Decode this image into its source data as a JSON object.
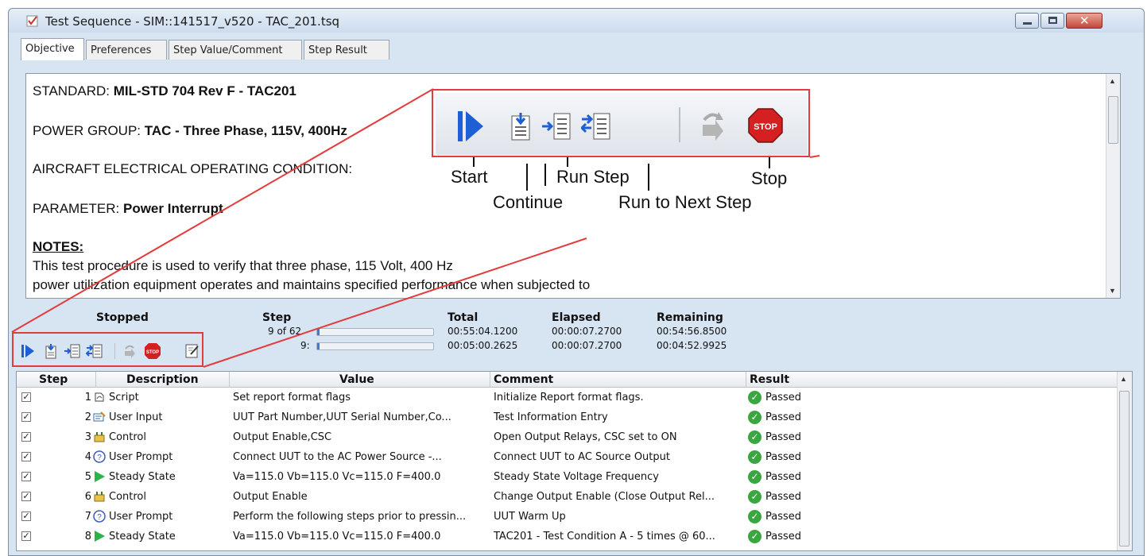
{
  "window": {
    "title": "Test Sequence - SIM::141517_v520 - TAC_201.tsq",
    "buttons": [
      "minimize",
      "maximize",
      "close"
    ]
  },
  "tabs": [
    {
      "label": "Objective",
      "active": true
    },
    {
      "label": "Preferences",
      "active": false
    },
    {
      "label": "Step Value/Comment",
      "active": false
    },
    {
      "label": "Step Result",
      "active": false
    }
  ],
  "objective": {
    "standard_label": "STANDARD: ",
    "standard_value": "MIL-STD 704 Rev F - TAC201",
    "power_group_label": "POWER GROUP: ",
    "power_group_value": "TAC - Three Phase, 115V, 400Hz",
    "condition_label": "AIRCRAFT ELECTRICAL OPERATING CONDITION:",
    "parameter_label": "PARAMETER:  ",
    "parameter_value": "Power Interrupt",
    "notes_heading": "NOTES:",
    "notes_line1": "This test procedure is used to verify that three phase, 115 Volt, 400 Hz",
    "notes_line2": "power utilization equipment operates and maintains specified performance when subjected to"
  },
  "callout": {
    "start": "Start",
    "continue": "Continue",
    "run_step": "Run Step",
    "run_to_next_step": "Run to Next Step",
    "stop": "Stop",
    "stop_icon_text": "STOP"
  },
  "status": {
    "state": "Stopped",
    "step_header": "Step",
    "step_value": "9 of 62",
    "step_sub": "9:",
    "total_header": "Total",
    "total_1": "00:55:04.1200",
    "total_2": "00:05:00.2625",
    "elapsed_header": "Elapsed",
    "elapsed_1": "00:00:07.2700",
    "elapsed_2": "00:00:07.2700",
    "remaining_header": "Remaining",
    "remaining_1": "00:54:56.8500",
    "remaining_2": "00:04:52.9925",
    "progress_overall": 0.02,
    "progress_step": 0.02
  },
  "grid": {
    "headers": {
      "step": "Step",
      "description": "Description",
      "value": "Value",
      "comment": "Comment",
      "result": "Result"
    },
    "rows": [
      {
        "n": "1",
        "icon": "script-icon",
        "desc": "Script",
        "value": "Set report format flags",
        "comment": "Initialize Report format flags.",
        "result": "Passed"
      },
      {
        "n": "2",
        "icon": "user-input-icon",
        "desc": "User Input",
        "value": "UUT Part Number,UUT Serial Number,Co...",
        "comment": "Test Information Entry",
        "result": "Passed"
      },
      {
        "n": "3",
        "icon": "control-icon",
        "desc": "Control",
        "value": "Output Enable,CSC",
        "comment": "Open Output Relays, CSC set to ON",
        "result": "Passed"
      },
      {
        "n": "4",
        "icon": "user-prompt-icon",
        "desc": "User Prompt",
        "value": "Connect  UUT to the AC Power Source  -...",
        "comment": "Connect UUT to AC Source Output",
        "result": "Passed"
      },
      {
        "n": "5",
        "icon": "steady-state-icon",
        "desc": "Steady State",
        "value": "Va=115.0 Vb=115.0 Vc=115.0 F=400.0",
        "comment": "Steady State Voltage Frequency",
        "result": "Passed"
      },
      {
        "n": "6",
        "icon": "control-icon",
        "desc": "Control",
        "value": "Output Enable",
        "comment": "Change Output Enable (Close Output Rel...",
        "result": "Passed"
      },
      {
        "n": "7",
        "icon": "user-prompt-icon",
        "desc": "User Prompt",
        "value": "Perform the following steps prior to pressin...",
        "comment": "UUT Warm Up",
        "result": "Passed"
      },
      {
        "n": "8",
        "icon": "steady-state-icon",
        "desc": "Steady State",
        "value": "Va=115.0 Vb=115.0 Vc=115.0 F=400.0",
        "comment": "TAC201 - Test Condition A - 5 times @ 60...",
        "result": "Passed"
      }
    ]
  },
  "colors": {
    "annotation_red": "#e33c3c",
    "accent_blue": "#1f5fd6",
    "passed_green": "#3aa63f",
    "stop_red": "#d42020"
  }
}
